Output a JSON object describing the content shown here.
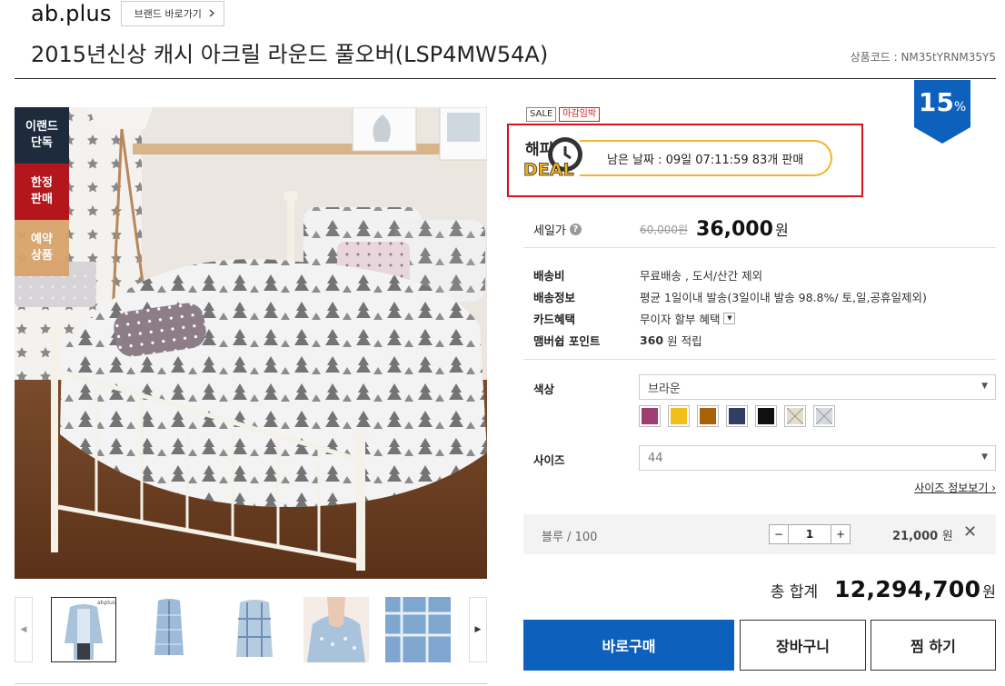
{
  "header": {
    "brand": "ab.plus",
    "brand_link": "브랜드 바로가기",
    "title": "2015년신상 캐시 아크릴 라운드 풀오버(LSP4MW54A)",
    "product_code": "상품코드 : NM35tYRNM35Y5"
  },
  "side_badges": [
    {
      "label": "이랜드 단독",
      "color": "#1e2b3c"
    },
    {
      "label": "한정 판매",
      "color": "#b3161b"
    },
    {
      "label": "예약 상품",
      "color": "#d9a26b"
    }
  ],
  "thumbnails": {
    "brand_mark": "abplus",
    "items": [
      "thumb-1",
      "thumb-2",
      "thumb-3",
      "thumb-4",
      "thumb-5"
    ]
  },
  "discount": {
    "value": "15",
    "unit": "%",
    "color": "#0d61bd"
  },
  "tags": [
    "SALE",
    "마감임박"
  ],
  "deal": {
    "logo_top": "해피",
    "logo_bottom": "DEAL",
    "text": "남은 날짜 : 09일 07:11:59 83개 판매"
  },
  "price": {
    "label": "세일가",
    "original": "60,000원",
    "sale": "36,000",
    "won": "원"
  },
  "info": [
    {
      "key": "배송비",
      "value": "무료배송 , 도서/산간 제외"
    },
    {
      "key": "배송정보",
      "value": "평균 1일이내 발송(3일이내 발송 98.8%/ 토,일,공휴일제외)"
    },
    {
      "key": "카드혜택",
      "value": "무이자 할부 혜택"
    },
    {
      "key": "맴버쉽 포인트",
      "value_bold": "360",
      "value_rest": "원 적립"
    }
  ],
  "options": {
    "color_label": "색상",
    "color_selected": "브라운",
    "swatches": [
      "#9e3d73",
      "#f2be18",
      "#a86108",
      "#2f3f62",
      "#111111",
      "#e6dccb",
      "#d6d9de"
    ],
    "size_label": "사이즈",
    "size_selected": "44",
    "size_info": "사이즈 정보보기"
  },
  "selected": {
    "name": "블루 / 100",
    "qty": "1",
    "price": "21,000",
    "won": "원",
    "remove": "✕"
  },
  "total": {
    "label": "총 합계",
    "value": "12,294,700",
    "won": "원"
  },
  "buttons": {
    "buy": "바로구매",
    "cart": "장바구니",
    "wish": "찜 하기"
  }
}
